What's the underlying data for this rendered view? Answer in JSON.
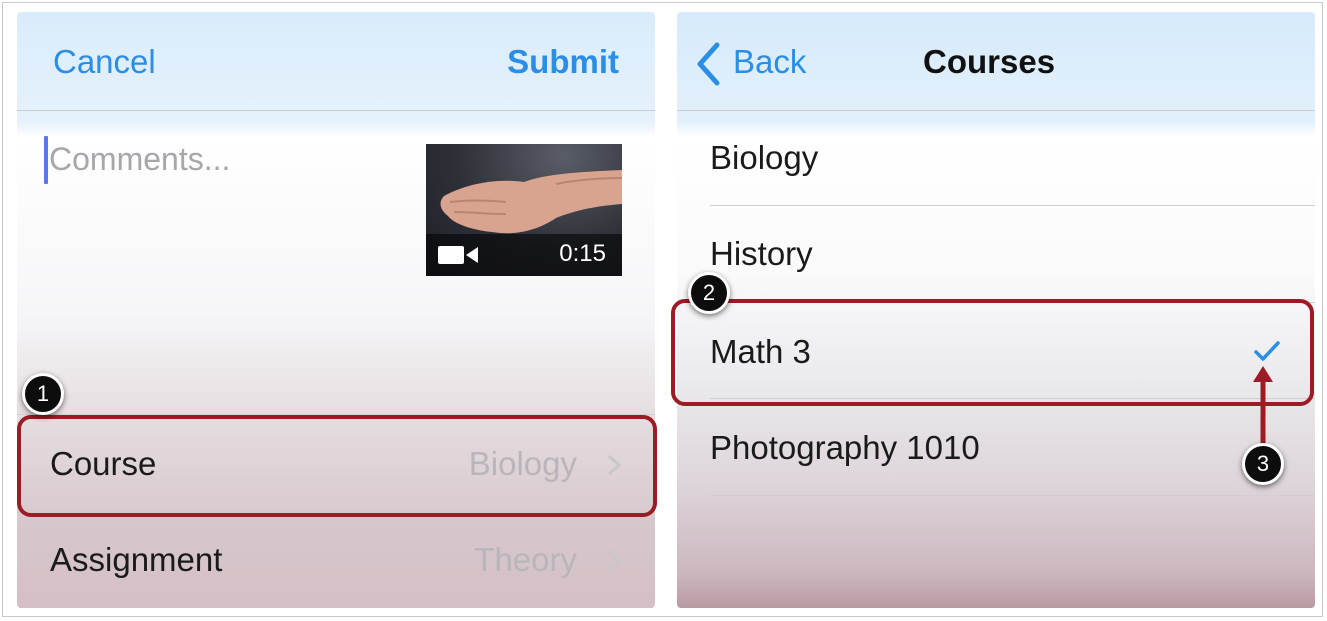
{
  "left_screen": {
    "nav": {
      "cancel_label": "Cancel",
      "submit_label": "Submit"
    },
    "comments": {
      "placeholder": "Comments..."
    },
    "video": {
      "duration": "0:15",
      "icon": "video-camera-icon"
    },
    "rows": [
      {
        "label": "Course",
        "value": "Biology"
      },
      {
        "label": "Assignment",
        "value": "Theory"
      }
    ]
  },
  "right_screen": {
    "nav": {
      "back_label": "Back",
      "title": "Courses"
    },
    "courses": [
      {
        "label": "Biology",
        "selected": false
      },
      {
        "label": "History",
        "selected": false
      },
      {
        "label": "Math 3",
        "selected": true
      },
      {
        "label": "Photography 1010",
        "selected": false
      }
    ]
  },
  "callouts": [
    "1",
    "2",
    "3"
  ],
  "colors": {
    "accent": "#2b8ee6",
    "highlight": "#9b1c24",
    "badge": "#0d0d0d"
  }
}
